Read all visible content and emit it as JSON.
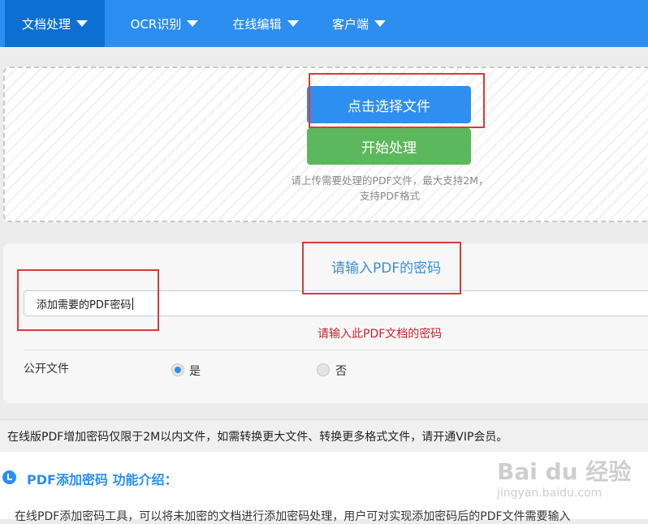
{
  "nav": {
    "items": [
      {
        "label": "文档处理"
      },
      {
        "label": "OCR识别"
      },
      {
        "label": "在线编辑"
      },
      {
        "label": "客户端"
      }
    ]
  },
  "upload": {
    "choose_label": "点击选择文件",
    "start_label": "开始处理",
    "hint_line1": "请上传需要处理的PDF文件，最大支持2M，",
    "hint_line2": "支持PDF格式"
  },
  "password": {
    "title": "请输入PDF的密码",
    "input_value": "添加需要的PDF密码",
    "error_text": "请输入此PDF文档的密码",
    "public_label": "公开文件",
    "option_yes": "是",
    "option_no": "否",
    "selected": "是"
  },
  "notice": "在线版PDF增加密码仅限于2M以内文件，如需转换更大文件、转换更多格式文件，请开通VIP会员。",
  "intro": {
    "title": "PDF添加密码 功能介绍：",
    "body": "在线PDF添加密码工具，可以将未加密的文档进行添加密码处理，用户可对实现添加密码后的PDF文件需要输入"
  },
  "watermark": {
    "main": "Bai du 经验",
    "sub": "jingyan.baidu.com"
  },
  "colors": {
    "nav_bg": "#2b8ef0",
    "nav_active": "#0c6fd4",
    "choose_btn": "#2f8ff0",
    "start_btn": "#5cb85c",
    "error": "#c8252b",
    "annotation": "#d93a3a"
  }
}
